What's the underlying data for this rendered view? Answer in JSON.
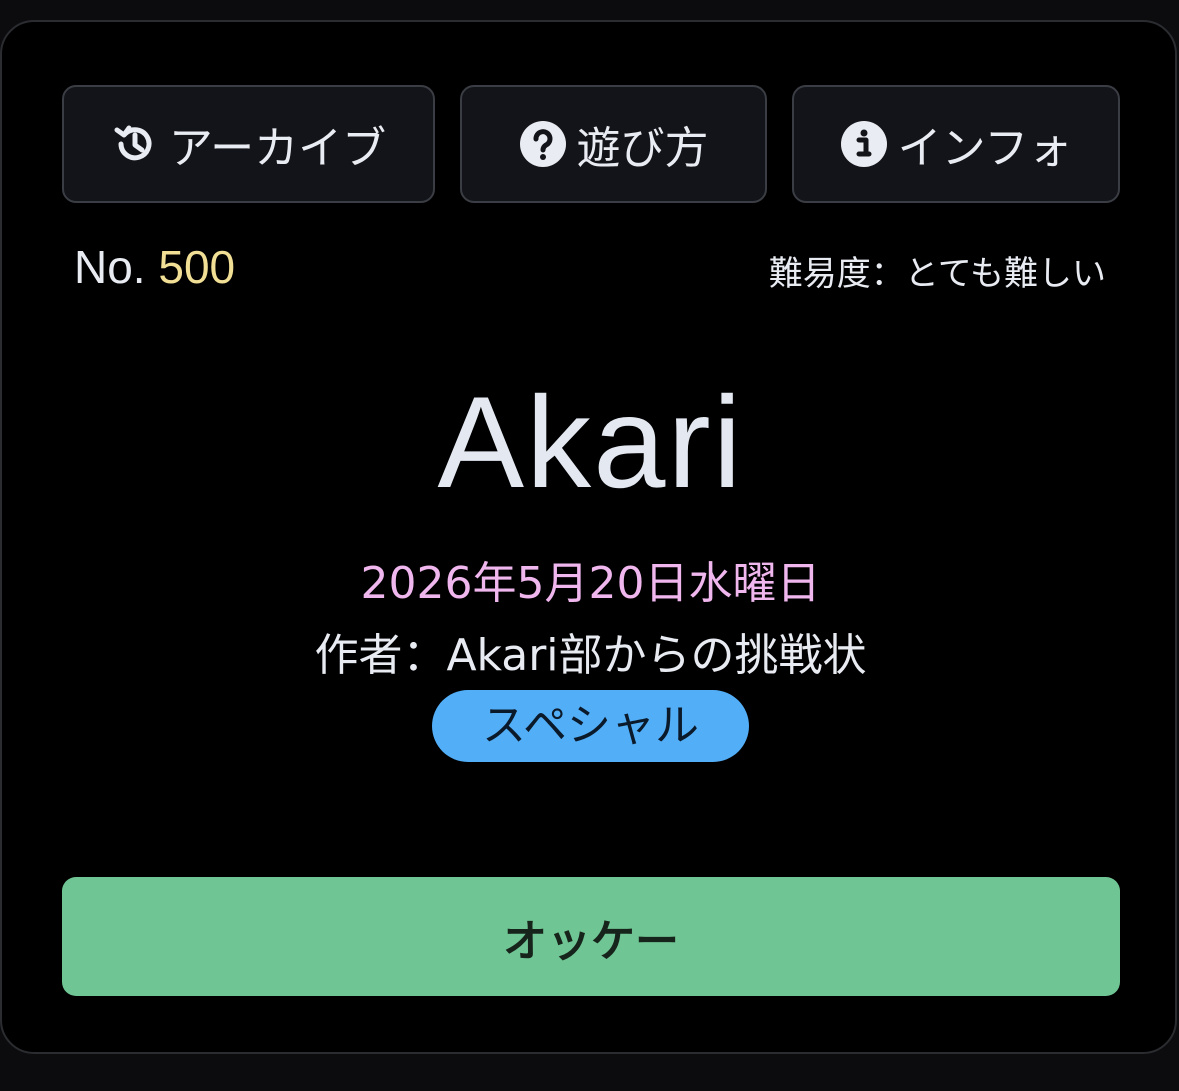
{
  "toolbar": {
    "archive_label": "アーカイブ",
    "howto_label": "遊び方",
    "info_label": "インフォ"
  },
  "icons": {
    "archive": "history-icon",
    "howto": "question-circle-icon",
    "info": "info-circle-icon"
  },
  "puzzle": {
    "number_prefix": "No.",
    "number": "500",
    "difficulty": "難易度：とても難しい",
    "title": "Akari",
    "date": "2026年5月20日水曜日",
    "author": "作者：Akari部からの挑戦状",
    "badge": "スペシャル"
  },
  "actions": {
    "ok_label": "オッケー"
  },
  "colors": {
    "background": "#000000",
    "number_accent": "#f2df96",
    "date_accent": "#f0b6ee",
    "badge": "#52aef7",
    "ok_button": "#6fc593"
  }
}
